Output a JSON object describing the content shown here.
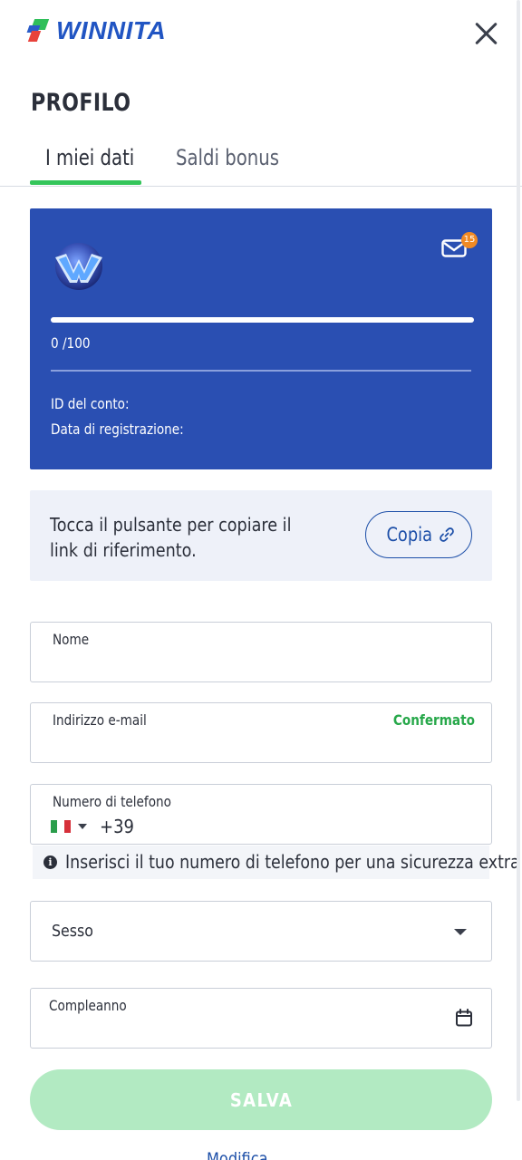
{
  "header": {
    "logo_text": "WINNITA",
    "close_icon": "close-icon"
  },
  "page": {
    "title": "PROFILO"
  },
  "tabs": [
    {
      "label": "I miei dati",
      "active": true
    },
    {
      "label": "Saldi bonus",
      "active": false
    }
  ],
  "profile_card": {
    "background": "#2a4fb2",
    "badge_icon": "winnita-level-badge-icon",
    "mail_icon": "envelope-icon",
    "unread_count": "15",
    "progress_fraction": 0,
    "progress_text": "0 /100",
    "account_id_label": "ID del conto:",
    "registration_date_label": "Data di registrazione:"
  },
  "referral": {
    "text": "Tocca il pulsante per copiare il link di riferimento.",
    "copy_label": "Copia",
    "copy_icon": "link-icon"
  },
  "form": {
    "name": {
      "label": "Nome",
      "value": ""
    },
    "email": {
      "label": "Indirizzo e-mail",
      "value": "",
      "status": "Confermato",
      "status_color": "#27a84a"
    },
    "phone": {
      "label": "Numero di telefono",
      "country_flag": "italy-flag-icon",
      "dial_code": "+39",
      "value": ""
    },
    "phone_hint": "Inserisci il tuo numero di telefono per una sicurezza extra",
    "gender": {
      "label": "Sesso"
    },
    "birthday": {
      "label": "Compleanno",
      "icon": "calendar-icon"
    },
    "save_label": "SALVA",
    "save_color": "#b2eac2"
  },
  "footer": {
    "link_text": "Modifica"
  }
}
